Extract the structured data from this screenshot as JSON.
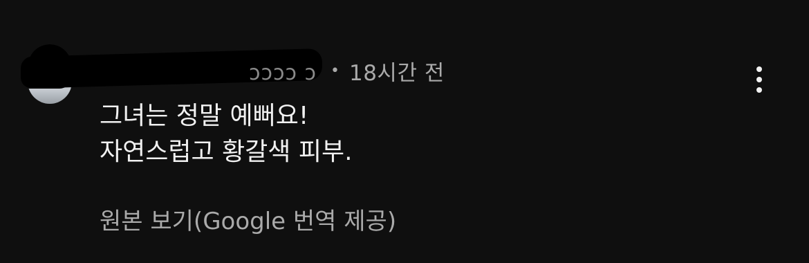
{
  "comment": {
    "author_fragment": "ɔɔɔɔ ɔ",
    "separator": "•",
    "timestamp": "18시간 전",
    "body_lines": [
      "그녀는 정말 예뻐요!",
      "자연스럽고 황갈색 피부."
    ],
    "translate_link": "원본 보기(Google 번역 제공)",
    "more_icon": "more-vert-icon"
  }
}
